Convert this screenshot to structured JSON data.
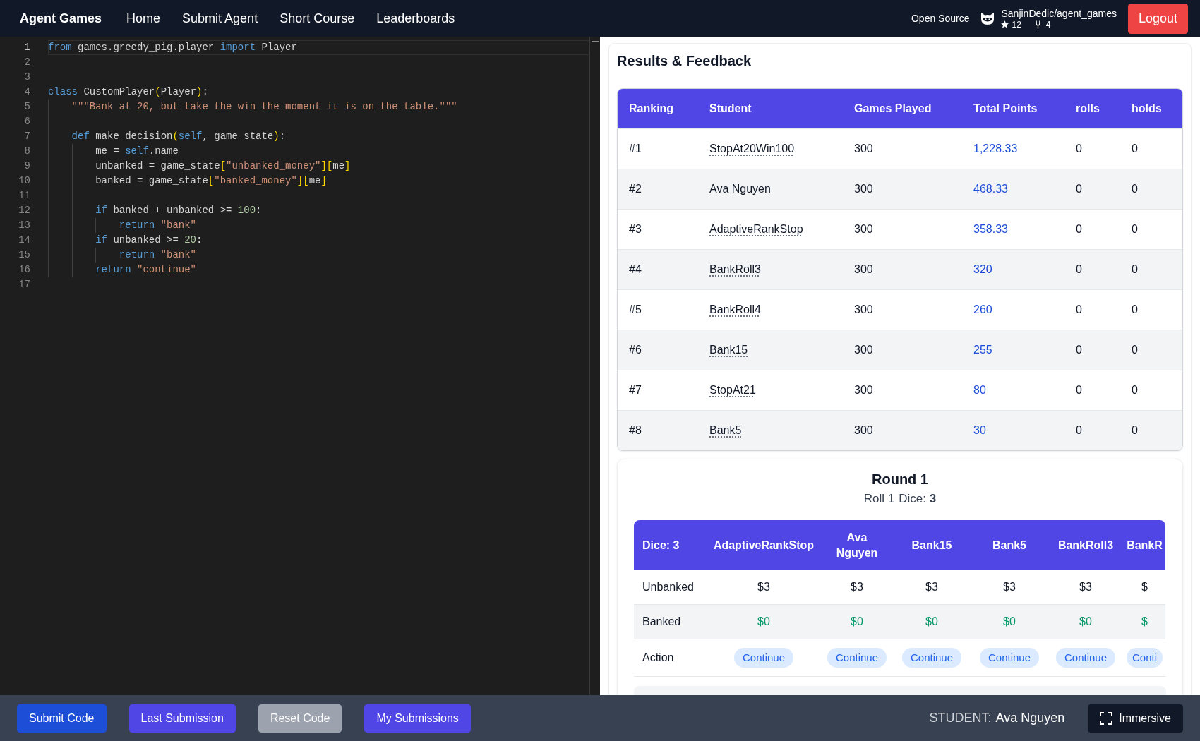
{
  "navbar": {
    "brand": "Agent Games",
    "links": [
      {
        "label": "Home"
      },
      {
        "label": "Submit Agent"
      },
      {
        "label": "Short Course"
      },
      {
        "label": "Leaderboards"
      }
    ],
    "open_source": "Open Source",
    "repo": {
      "name": "SanjinDedic/agent_games",
      "stars": "12",
      "forks": "4"
    },
    "logout": "Logout"
  },
  "editor": {
    "lines": [
      {
        "number": "1",
        "current": true,
        "tokens": [
          {
            "kind": "keyword",
            "text": "from"
          },
          {
            "kind": "plain",
            "text": " games.greedy_pig.player "
          },
          {
            "kind": "keyword",
            "text": "import"
          },
          {
            "kind": "plain",
            "text": " Player"
          }
        ]
      },
      {
        "number": "2",
        "current": false
      },
      {
        "number": "3",
        "current": false
      },
      {
        "number": "4",
        "current": false,
        "tokens": [
          {
            "kind": "keyword",
            "text": "class"
          },
          {
            "kind": "plain",
            "text": " CustomPlayer"
          },
          {
            "kind": "bracket",
            "text": "("
          },
          {
            "kind": "plain",
            "text": "Player"
          },
          {
            "kind": "bracket",
            "text": ")"
          },
          {
            "kind": "plain",
            "text": ":"
          }
        ]
      },
      {
        "number": "5",
        "current": false,
        "tokens": [
          {
            "kind": "string",
            "text": "    \"\"\"Bank at 20, but take the win the moment it is on the table.\"\"\""
          }
        ]
      },
      {
        "number": "6",
        "current": false
      },
      {
        "number": "7",
        "current": false,
        "tokens": [
          {
            "kind": "keyword",
            "text": "    def"
          },
          {
            "kind": "plain",
            "text": " make_decision"
          },
          {
            "kind": "bracket",
            "text": "("
          },
          {
            "kind": "keyword",
            "text": "self"
          },
          {
            "kind": "plain",
            "text": ", game_state"
          },
          {
            "kind": "bracket",
            "text": ")"
          },
          {
            "kind": "plain",
            "text": ":"
          }
        ]
      },
      {
        "number": "8",
        "current": false,
        "tokens": [
          {
            "kind": "plain",
            "text": "        me = "
          },
          {
            "kind": "keyword",
            "text": "self"
          },
          {
            "kind": "plain",
            "text": ".name"
          }
        ]
      },
      {
        "number": "9",
        "current": false,
        "tokens": [
          {
            "kind": "plain",
            "text": "        unbanked = game_state"
          },
          {
            "kind": "bracket",
            "text": "["
          },
          {
            "kind": "string",
            "text": "\"unbanked_money\""
          },
          {
            "kind": "bracket",
            "text": "]["
          },
          {
            "kind": "plain",
            "text": "me"
          },
          {
            "kind": "bracket",
            "text": "]"
          }
        ]
      },
      {
        "number": "10",
        "current": false,
        "tokens": [
          {
            "kind": "plain",
            "text": "        banked = game_state"
          },
          {
            "kind": "bracket",
            "text": "["
          },
          {
            "kind": "string",
            "text": "\"banked_money\""
          },
          {
            "kind": "bracket",
            "text": "]["
          },
          {
            "kind": "plain",
            "text": "me"
          },
          {
            "kind": "bracket",
            "text": "]"
          }
        ]
      },
      {
        "number": "11",
        "current": false
      },
      {
        "number": "12",
        "current": false,
        "tokens": [
          {
            "kind": "keyword",
            "text": "        if"
          },
          {
            "kind": "plain",
            "text": " banked + unbanked >= "
          },
          {
            "kind": "number",
            "text": "100"
          },
          {
            "kind": "plain",
            "text": ":"
          }
        ]
      },
      {
        "number": "13",
        "current": false,
        "tokens": [
          {
            "kind": "keyword",
            "text": "            return"
          },
          {
            "kind": "string",
            "text": " \"bank\""
          }
        ]
      },
      {
        "number": "14",
        "current": false,
        "tokens": [
          {
            "kind": "keyword",
            "text": "        if"
          },
          {
            "kind": "plain",
            "text": " unbanked >= "
          },
          {
            "kind": "number",
            "text": "20"
          },
          {
            "kind": "plain",
            "text": ":"
          }
        ]
      },
      {
        "number": "15",
        "current": false,
        "tokens": [
          {
            "kind": "keyword",
            "text": "            return"
          },
          {
            "kind": "string",
            "text": " \"bank\""
          }
        ]
      },
      {
        "number": "16",
        "current": false,
        "tokens": [
          {
            "kind": "keyword",
            "text": "        return"
          },
          {
            "kind": "string",
            "text": " \"continue\""
          }
        ]
      },
      {
        "number": "17",
        "current": false
      }
    ]
  },
  "results": {
    "title": "Results & Feedback",
    "columns": [
      "Ranking",
      "Student",
      "Games Played",
      "Total Points",
      "rolls",
      "holds"
    ],
    "rows": [
      {
        "ranking": "#1",
        "student": "StopAt20Win100",
        "underlined": true,
        "games_played": "300",
        "total_points": "1,228.33",
        "rolls": "0",
        "holds": "0"
      },
      {
        "ranking": "#2",
        "student": "Ava Nguyen",
        "underlined": false,
        "games_played": "300",
        "total_points": "468.33",
        "rolls": "0",
        "holds": "0"
      },
      {
        "ranking": "#3",
        "student": "AdaptiveRankStop",
        "underlined": true,
        "games_played": "300",
        "total_points": "358.33",
        "rolls": "0",
        "holds": "0"
      },
      {
        "ranking": "#4",
        "student": "BankRoll3",
        "underlined": true,
        "games_played": "300",
        "total_points": "320",
        "rolls": "0",
        "holds": "0"
      },
      {
        "ranking": "#5",
        "student": "BankRoll4",
        "underlined": true,
        "games_played": "300",
        "total_points": "260",
        "rolls": "0",
        "holds": "0"
      },
      {
        "ranking": "#6",
        "student": "Bank15",
        "underlined": true,
        "games_played": "300",
        "total_points": "255",
        "rolls": "0",
        "holds": "0"
      },
      {
        "ranking": "#7",
        "student": "StopAt21",
        "underlined": true,
        "games_played": "300",
        "total_points": "80",
        "rolls": "0",
        "holds": "0"
      },
      {
        "ranking": "#8",
        "student": "Bank5",
        "underlined": true,
        "games_played": "300",
        "total_points": "30",
        "rolls": "0",
        "holds": "0"
      }
    ]
  },
  "round": {
    "title": "Round 1",
    "roll": "Roll 1",
    "dice": "Dice: **3**",
    "table": {
      "corner": "Dice: 3",
      "players": [
        "AdaptiveRankStop",
        "Ava Nguyen",
        "Bank15",
        "Bank5",
        "BankRoll3",
        "BankR"
      ],
      "rows": [
        {
          "label": "Unbanked",
          "kind": "amount",
          "values": [
            "$3",
            "$3",
            "$3",
            "$3",
            "$3",
            "$"
          ]
        },
        {
          "label": "Banked",
          "kind": "banked",
          "values": [
            "$0",
            "$0",
            "$0",
            "$0",
            "$0",
            "$"
          ]
        },
        {
          "label": "Action",
          "kind": "action",
          "values": [
            "Continue",
            "Continue",
            "Continue",
            "Continue",
            "Continue",
            "Conti"
          ]
        }
      ]
    }
  },
  "footer": {
    "buttons": [
      {
        "label": "Submit Code",
        "kind": "primary",
        "disabled": false
      },
      {
        "label": "Last Submission",
        "kind": "accent",
        "disabled": false
      },
      {
        "label": "Reset Code",
        "kind": "neutral",
        "disabled": true
      },
      {
        "label": "My Submissions",
        "kind": "accent",
        "disabled": false
      }
    ],
    "student_label": "STUDENT:",
    "student_name": "Ava Nguyen",
    "immersive": "Immersive"
  }
}
